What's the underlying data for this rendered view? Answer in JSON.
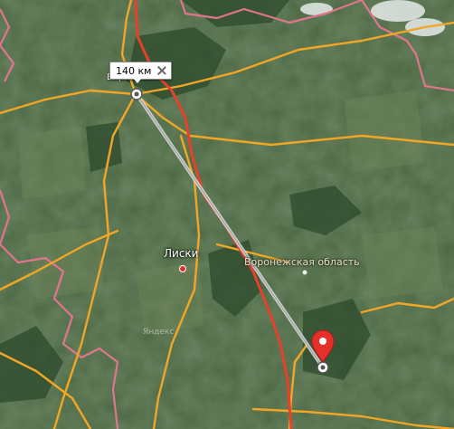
{
  "map": {
    "ruler_distance": "140 км",
    "top_city_partial": "Воронеж",
    "city_label": "Лиски",
    "region_label": "Воронежская область",
    "watermark": "Яндекс"
  },
  "colors": {
    "satellite_base": "#3d5a3a",
    "road_orange": "#f2a626",
    "border_pink": "#e0758d",
    "route_red": "#e8402b",
    "marker_red": "#e5302a"
  },
  "icons": {
    "ruler_close": "close-icon",
    "start_point": "ruler-point-icon",
    "end_marker": "location-pin-icon",
    "city_dot": "city-dot-icon"
  }
}
